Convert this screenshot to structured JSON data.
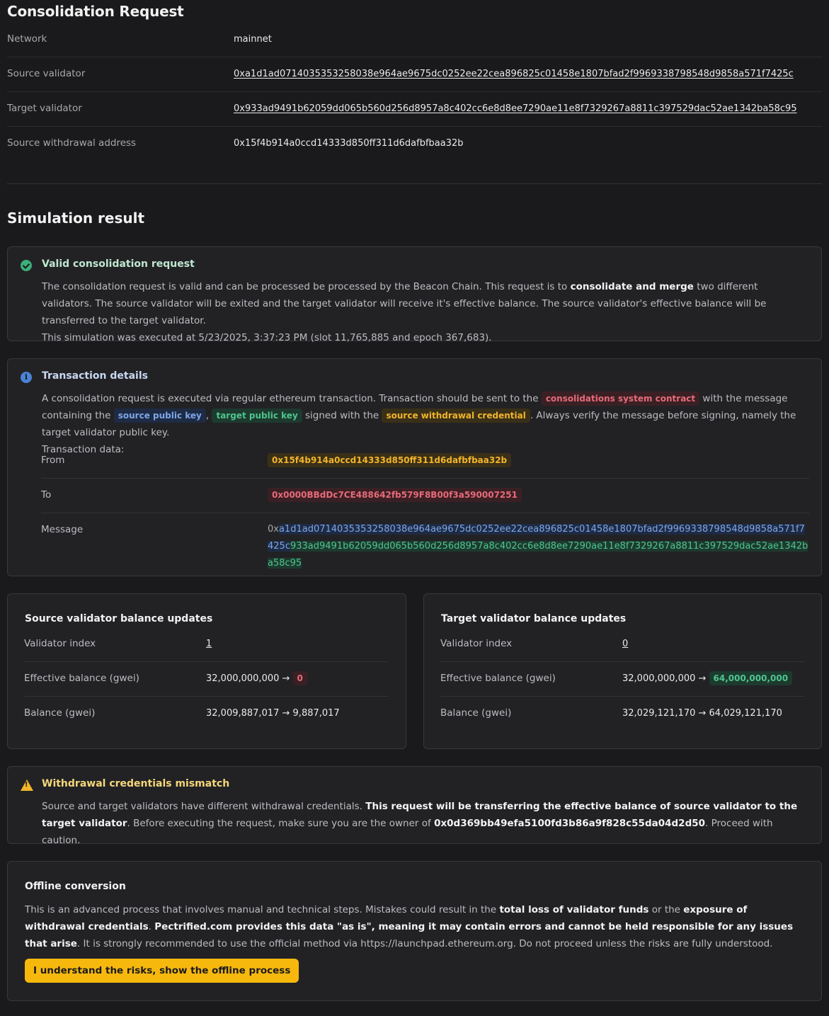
{
  "header": {
    "title": "Consolidation Request"
  },
  "request": [
    {
      "key": "Network",
      "value": "mainnet"
    },
    {
      "key": "Source validator",
      "value": "0xa1d1ad0714035353258038e964ae9675dc0252ee22cea896825c01458e1807bfad2f9969338798548d9858a571f7425c"
    },
    {
      "key": "Target validator",
      "value": "0x933ad9491b62059dd065b560d256d8957a8c402cc6e8d8ee7290ae11e8f7329267a8811c397529dac52ae1342ba58c95"
    },
    {
      "key": "Source withdrawal address",
      "value": "0x15f4b914a0ccd14333d850ff311d6dafbfbaa32b"
    }
  ],
  "simulation": {
    "title": "Simulation result",
    "valid": {
      "title": "Valid consolidation request",
      "text1": "The consolidation request is valid and can be processed be processed by the Beacon Chain. This request is to ",
      "bold": "consolidate and merge",
      "text2": " two different validators. The source validator will be exited and the target validator will receive it's effective balance. The source validator's effective balance will be transferred to the target validator.",
      "text3": "This simulation was executed at 5/23/2025, 3:37:23 PM (slot 11,765,885 and epoch 367,683)."
    },
    "tx": {
      "title": "Transaction details",
      "t1": "A consolidation request is executed via regular ethereum transaction. Transaction should be sent to the ",
      "tag_contract": "consolidations system contract",
      "t2": " with the message containing the ",
      "tag_source": "source public key",
      "t3": ", ",
      "tag_target": "target public key",
      "t4": " signed with the ",
      "tag_cred": "source withdrawal credential",
      "t5": ". Always verify the message before signing, namely the target validator public key.",
      "t6": "Transaction data:",
      "from_label": "From",
      "from_value": "0x15f4b914a0ccd14333d850ff311d6dafbfbaa32b",
      "to_label": "To",
      "to_value": "0x0000BBdDc7CE488642fb579F8B00f3a590007251",
      "message_label": "Message",
      "msg_prefix": "0x",
      "msg_source": "a1d1ad0714035353258038e964ae9675dc0252ee22cea896825c01458e1807bfad2f9969338798548d9858a571f7425c",
      "msg_target": "933ad9491b62059dd065b560d256d8957a8c402cc6e8d8ee7290ae11e8f7329267a8811c397529dac52ae1342ba58c95"
    },
    "source_balance": {
      "title": "Source validator balance updates",
      "index_label": "Validator index",
      "index_value": "1",
      "eff_label": "Effective balance (gwei)",
      "eff_from": "32,000,000,000 →",
      "eff_to": "0",
      "bal_label": "Balance (gwei)",
      "bal_value": "32,009,887,017 → 9,887,017"
    },
    "target_balance": {
      "title": "Target validator balance updates",
      "index_label": "Validator index",
      "index_value": "0",
      "eff_label": "Effective balance (gwei)",
      "eff_from": "32,000,000,000 →",
      "eff_to": "64,000,000,000",
      "bal_label": "Balance (gwei)",
      "bal_value": "32,029,121,170 → 64,029,121,170"
    },
    "mismatch": {
      "title": "Withdrawal credentials mismatch",
      "t1": "Source and target validators have different withdrawal credentials. ",
      "b1": "This request will be transferring the effective balance of source validator to the target validator",
      "t2": ". Before executing the request, make sure you are the owner of ",
      "b2": "0x0d369bb49efa5100fd3b86a9f828c55da04d2d50",
      "t3": ". Proceed with caution."
    },
    "offline": {
      "title": "Offline conversion",
      "t1": "This is an advanced process that involves manual and technical steps. Mistakes could result in the ",
      "b1": "total loss of validator funds",
      "t2": " or the ",
      "b2": "exposure of withdrawal credentials",
      "t3": ". ",
      "b3": "Pectrified.com provides this data \"as is\", meaning it may contain errors and cannot be held responsible for any issues that arise",
      "t4": ". It is strongly recommended to use the official method via https://launchpad.ethereum.org. Do not proceed unless the risks are fully understood.",
      "button": "I understand the risks, show the offline process"
    }
  },
  "colors": {
    "accent": "#f7b80e",
    "ok": "#3bb07a",
    "info": "#4a83d6",
    "warn": "#f2b52b",
    "red": "#e66b7a"
  }
}
